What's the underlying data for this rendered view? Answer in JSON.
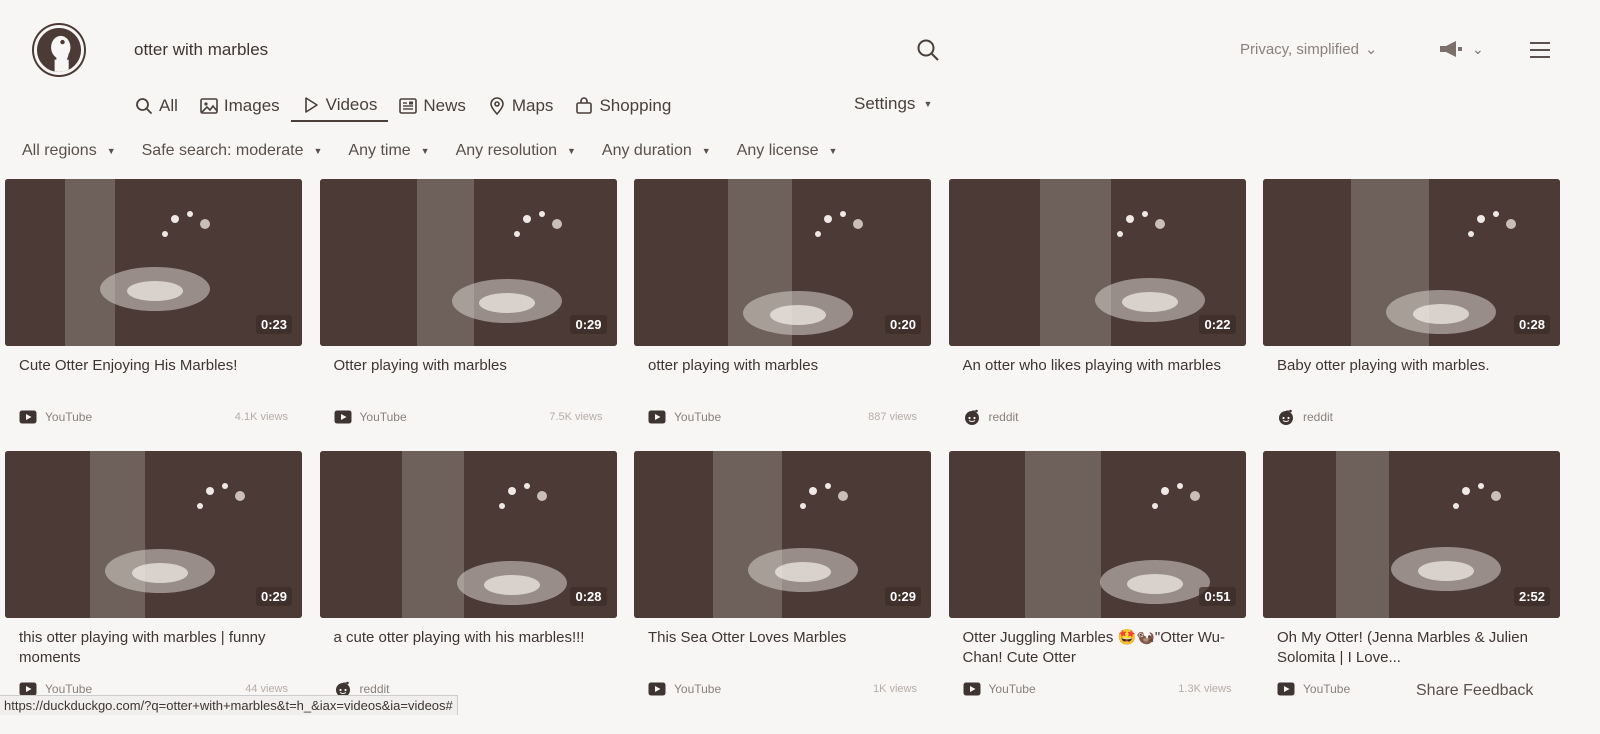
{
  "search": {
    "query": "otter with marbles"
  },
  "header": {
    "privacy_label": "Privacy, simplified"
  },
  "tabs": [
    {
      "label": "All",
      "icon": "search-icon"
    },
    {
      "label": "Images",
      "icon": "image-icon"
    },
    {
      "label": "Videos",
      "icon": "play-icon",
      "active": true
    },
    {
      "label": "News",
      "icon": "news-icon"
    },
    {
      "label": "Maps",
      "icon": "map-pin-icon"
    },
    {
      "label": "Shopping",
      "icon": "shopping-bag-icon"
    }
  ],
  "settings_label": "Settings",
  "filters": [
    "All regions",
    "Safe search: moderate",
    "Any time",
    "Any resolution",
    "Any duration",
    "Any license"
  ],
  "videos": [
    {
      "title": "Cute Otter Enjoying His Marbles!",
      "duration": "0:23",
      "source": "YouTube",
      "views": "4.1K views"
    },
    {
      "title": "Otter playing with marbles",
      "duration": "0:29",
      "source": "YouTube",
      "views": "7.5K views"
    },
    {
      "title": "otter playing with marbles",
      "duration": "0:20",
      "source": "YouTube",
      "views": "887 views"
    },
    {
      "title": "An otter who likes playing with marbles",
      "duration": "0:22",
      "source": "reddit",
      "views": ""
    },
    {
      "title": "Baby otter playing with marbles.",
      "duration": "0:28",
      "source": "reddit",
      "views": ""
    },
    {
      "title": "this otter playing with marbles | funny moments",
      "duration": "0:29",
      "source": "YouTube",
      "views": "44 views"
    },
    {
      "title": "a cute otter playing with his marbles!!!",
      "duration": "0:28",
      "source": "reddit",
      "views": ""
    },
    {
      "title": "This Sea Otter Loves Marbles",
      "duration": "0:29",
      "source": "YouTube",
      "views": "1K views"
    },
    {
      "title": "Otter Juggling Marbles 🤩🦦\"Otter Wu-Chan! Cute Otter",
      "duration": "0:51",
      "source": "YouTube",
      "views": "1.3K views"
    },
    {
      "title": "Oh My Otter! (Jenna Marbles & Julien Solomita | I Love...",
      "duration": "2:52",
      "source": "YouTube",
      "views": ""
    }
  ],
  "status_url": "https://duckduckgo.com/?q=otter+with+marbles&t=h_&iax=videos&ia=videos#",
  "share_feedback": "Share Feedback",
  "colors": {
    "thumb_dark": "#4b3a35",
    "text": "#3e3532",
    "muted": "#8a807c"
  }
}
